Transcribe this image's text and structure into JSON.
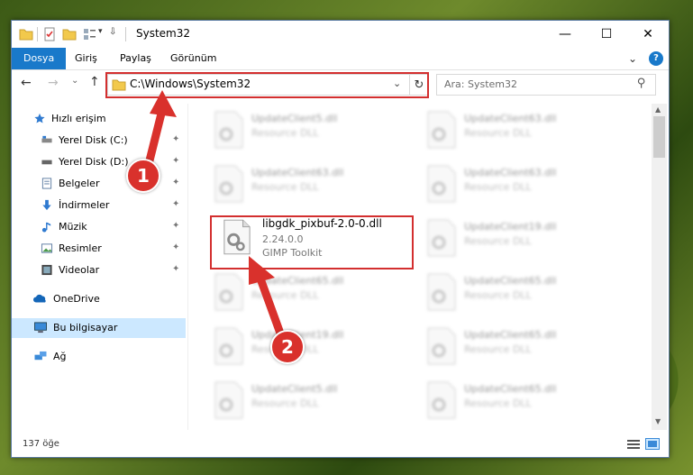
{
  "window": {
    "title": "System32",
    "controls": {
      "minimize": "—",
      "maximize": "☐",
      "close": "✕"
    }
  },
  "ribbon": {
    "tabs": [
      "Dosya",
      "Giriş",
      "Paylaş",
      "Görünüm"
    ],
    "expand": "⌄",
    "help": "?"
  },
  "nav": {
    "back": "←",
    "forward": "→",
    "recent": "⌄",
    "up": "↑",
    "address": "C:\\Windows\\System32",
    "address_dropdown": "⌄",
    "refresh": "↻",
    "search_placeholder": "Ara: System32",
    "search_icon": "⚲"
  },
  "sidebar": {
    "items": [
      {
        "label": "Hızlı erişim",
        "icon": "star-icon",
        "pinned": false
      },
      {
        "label": "Yerel Disk (C:)",
        "icon": "drive-icon",
        "pinned": true
      },
      {
        "label": "Yerel Disk (D:)",
        "icon": "drive-icon",
        "pinned": true
      },
      {
        "label": "Belgeler",
        "icon": "documents-icon",
        "pinned": true
      },
      {
        "label": "İndirmeler",
        "icon": "download-icon",
        "pinned": true
      },
      {
        "label": "Müzik",
        "icon": "music-icon",
        "pinned": true
      },
      {
        "label": "Resimler",
        "icon": "pictures-icon",
        "pinned": true
      },
      {
        "label": "Videolar",
        "icon": "video-icon",
        "pinned": true
      },
      {
        "label": "OneDrive",
        "icon": "cloud-icon",
        "pinned": false
      },
      {
        "label": "Bu bilgisayar",
        "icon": "computer-icon",
        "pinned": false
      },
      {
        "label": "Ağ",
        "icon": "network-icon",
        "pinned": false
      }
    ],
    "pin_glyph": "📌"
  },
  "files": {
    "highlighted": {
      "name": "libgdk_pixbuf-2.0-0.dll",
      "version": "2.24.0.0",
      "company": "GIMP Toolkit"
    },
    "left_column": [
      {
        "name": "UpdateClient5.dll",
        "desc": "Resource DLL"
      },
      {
        "name": "UpdateClient63.dll",
        "desc": "Resource DLL"
      },
      {
        "name": "UpdateClient65.dll",
        "desc": "Resource DLL"
      },
      {
        "name": "UpdateClient19.dll",
        "desc": "Resource DLL"
      },
      {
        "name": "UpdateClient5.dll",
        "desc": "Resource DLL"
      }
    ],
    "right_column": [
      {
        "name": "UpdateClient63.dll",
        "desc": "Resource DLL"
      },
      {
        "name": "UpdateClient63.dll",
        "desc": "Resource DLL"
      },
      {
        "name": "UpdateClient19.dll",
        "desc": "Resource DLL"
      },
      {
        "name": "UpdateClient65.dll",
        "desc": "Resource DLL"
      },
      {
        "name": "UpdateClient65.dll",
        "desc": "Resource DLL"
      },
      {
        "name": "UpdateClient65.dll",
        "desc": "Resource DLL"
      }
    ]
  },
  "status": {
    "count": "137 öğe"
  },
  "callouts": {
    "step1": "1",
    "step2": "2"
  },
  "colors": {
    "accent": "#1979ca",
    "highlight": "#d32f2f",
    "selected": "#cce8ff"
  }
}
